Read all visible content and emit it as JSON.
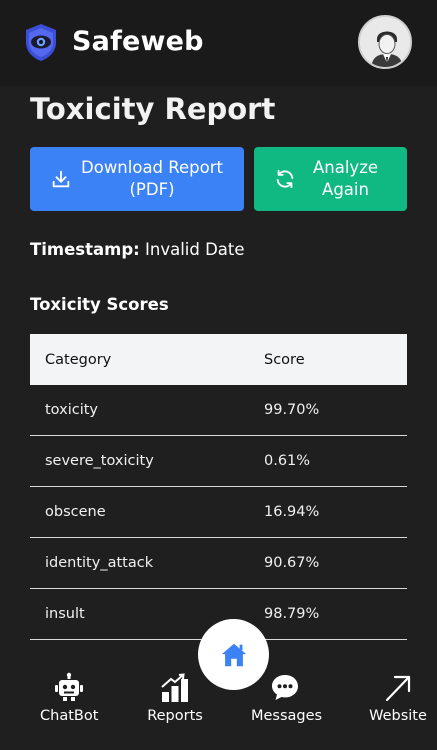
{
  "header": {
    "brand": "Safeweb",
    "avatar": "user-avatar"
  },
  "page": {
    "title": "Toxicity Report",
    "download_label": "Download Report (PDF)",
    "analyze_label": "Analyze Again",
    "timestamp_key": "Timestamp:",
    "timestamp_value": "Invalid Date",
    "section_title": "Toxicity Scores"
  },
  "table": {
    "headers": [
      "Category",
      "Score"
    ],
    "rows": [
      [
        "toxicity",
        "99.70%"
      ],
      [
        "severe_toxicity",
        "0.61%"
      ],
      [
        "obscene",
        "16.94%"
      ],
      [
        "identity_attack",
        "90.67%"
      ],
      [
        "insult",
        "98.79%"
      ]
    ]
  },
  "nav": {
    "items": [
      {
        "label": "ChatBot",
        "icon": "robot-icon"
      },
      {
        "label": "Reports",
        "icon": "reports-icon"
      },
      {
        "label": "Messages",
        "icon": "chat-bubble-icon"
      },
      {
        "label": "Website",
        "icon": "arrow-up-right-icon"
      }
    ],
    "home_icon": "home-icon"
  },
  "colors": {
    "background": "#1f1f1f",
    "download": "#3b82f6",
    "analyze": "#10b981",
    "home": "#3b82f6"
  }
}
